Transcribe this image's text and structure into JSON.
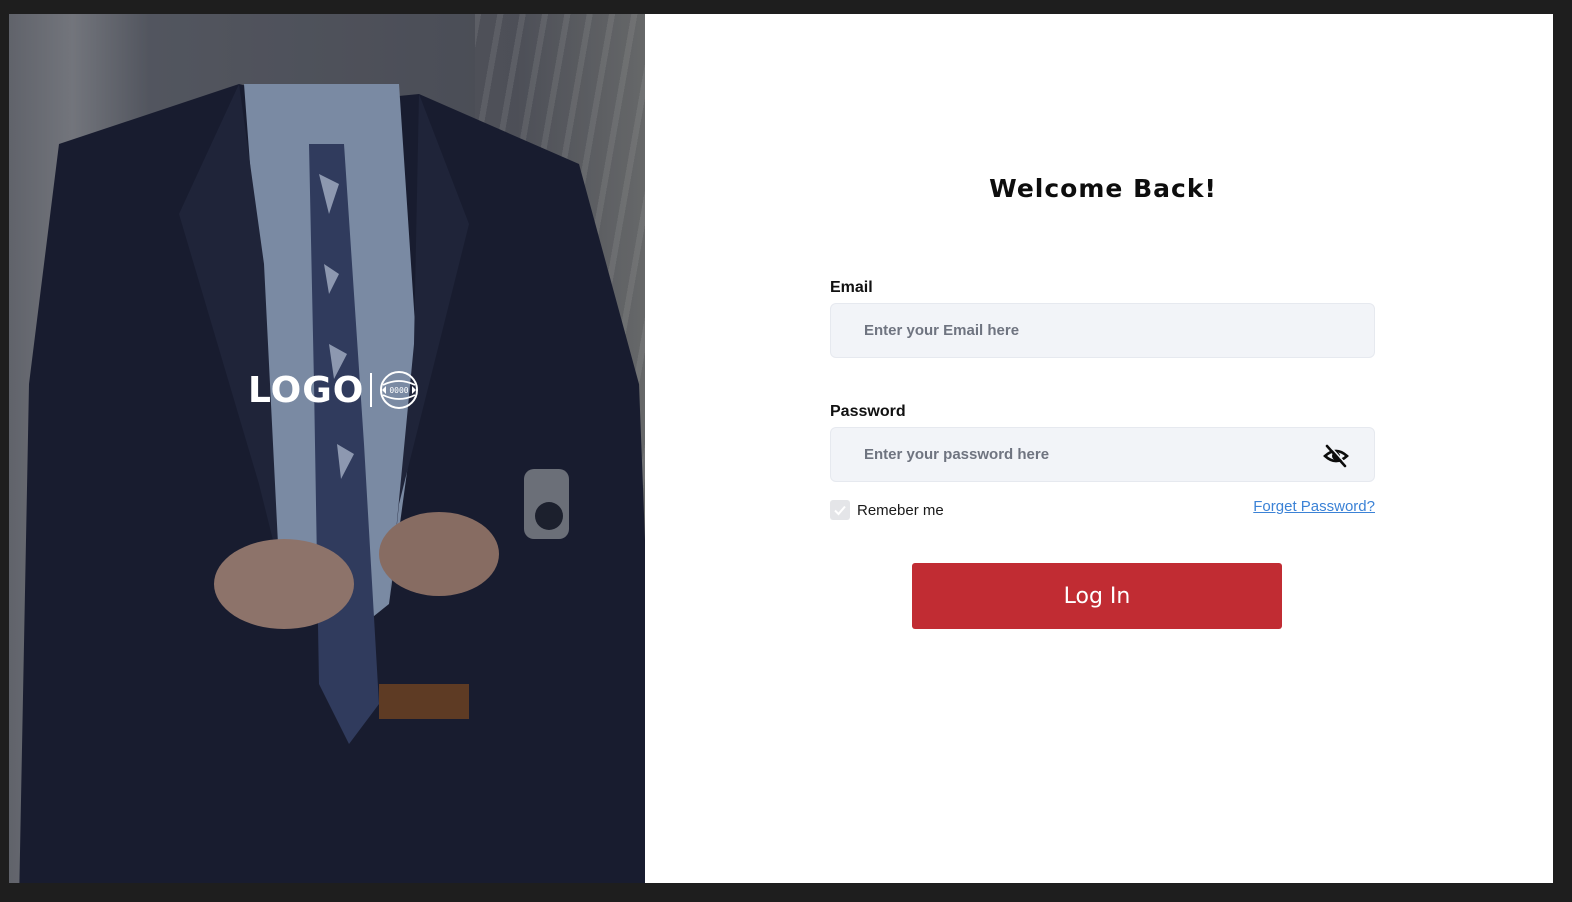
{
  "hero": {
    "logo_text": "LOGO",
    "emblem_icon": "badge-emblem-icon",
    "emblem_text": "0000"
  },
  "login": {
    "title": "Welcome Back!",
    "email": {
      "label": "Email",
      "placeholder": "Enter your Email here",
      "value": ""
    },
    "password": {
      "label": "Password",
      "placeholder": "Enter your password here",
      "value": "",
      "visibility_icon": "eye-slash-icon"
    },
    "remember_me": {
      "label": "Remeber me",
      "checked": true
    },
    "forgot_password_label": "Forget Password?",
    "submit_label": "Log In"
  },
  "colors": {
    "primary_button": "#c12c33",
    "link": "#3b82d6",
    "input_background": "#f2f4f8",
    "frame_background": "#1e1e1e"
  }
}
